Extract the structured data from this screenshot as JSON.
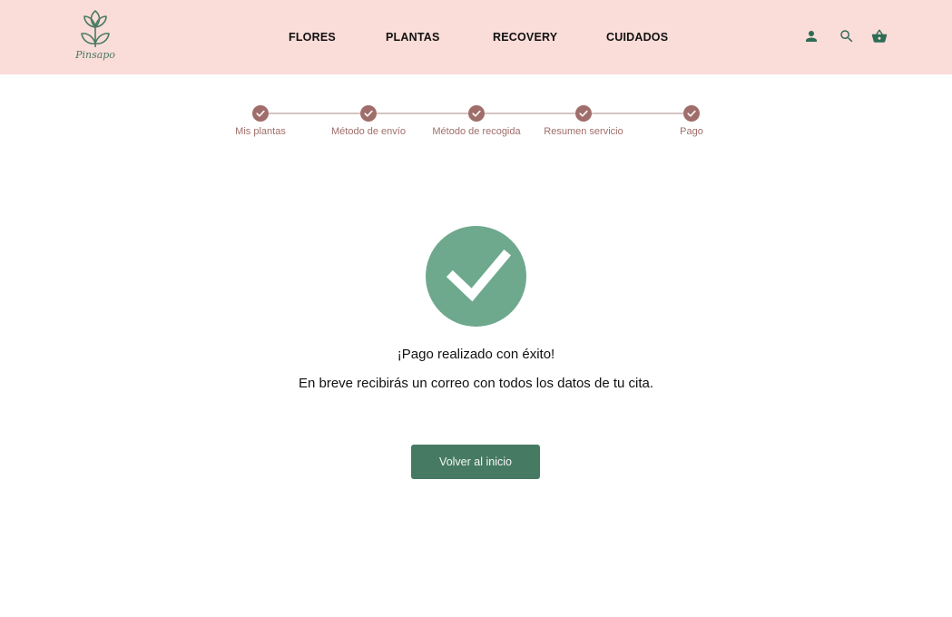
{
  "brand": {
    "name": "Pinsapo",
    "color": "#4a7a63"
  },
  "header": {
    "background": "#fadcd8",
    "nav": [
      {
        "label": "FLORES"
      },
      {
        "label": "PLANTAS"
      },
      {
        "label": "RECOVERY"
      },
      {
        "label": "CUIDADOS"
      }
    ],
    "icons": [
      "user-icon",
      "search-icon",
      "basket-icon"
    ]
  },
  "stepper": {
    "accent": "#a06e6a",
    "steps": [
      {
        "label": "Mis plantas",
        "completed": true
      },
      {
        "label": "Método de envío",
        "completed": true
      },
      {
        "label": "Método de recogida",
        "completed": true
      },
      {
        "label": "Resumen servicio",
        "completed": true
      },
      {
        "label": "Pago",
        "completed": true
      }
    ]
  },
  "confirmation": {
    "icon": "check-circle-icon",
    "icon_color": "#6ea98e",
    "title": "¡Pago realizado con éxito!",
    "message": "En breve recibirás un correo con todos los datos de tu cita.",
    "button_label": "Volver al inicio",
    "button_color": "#477a63"
  }
}
